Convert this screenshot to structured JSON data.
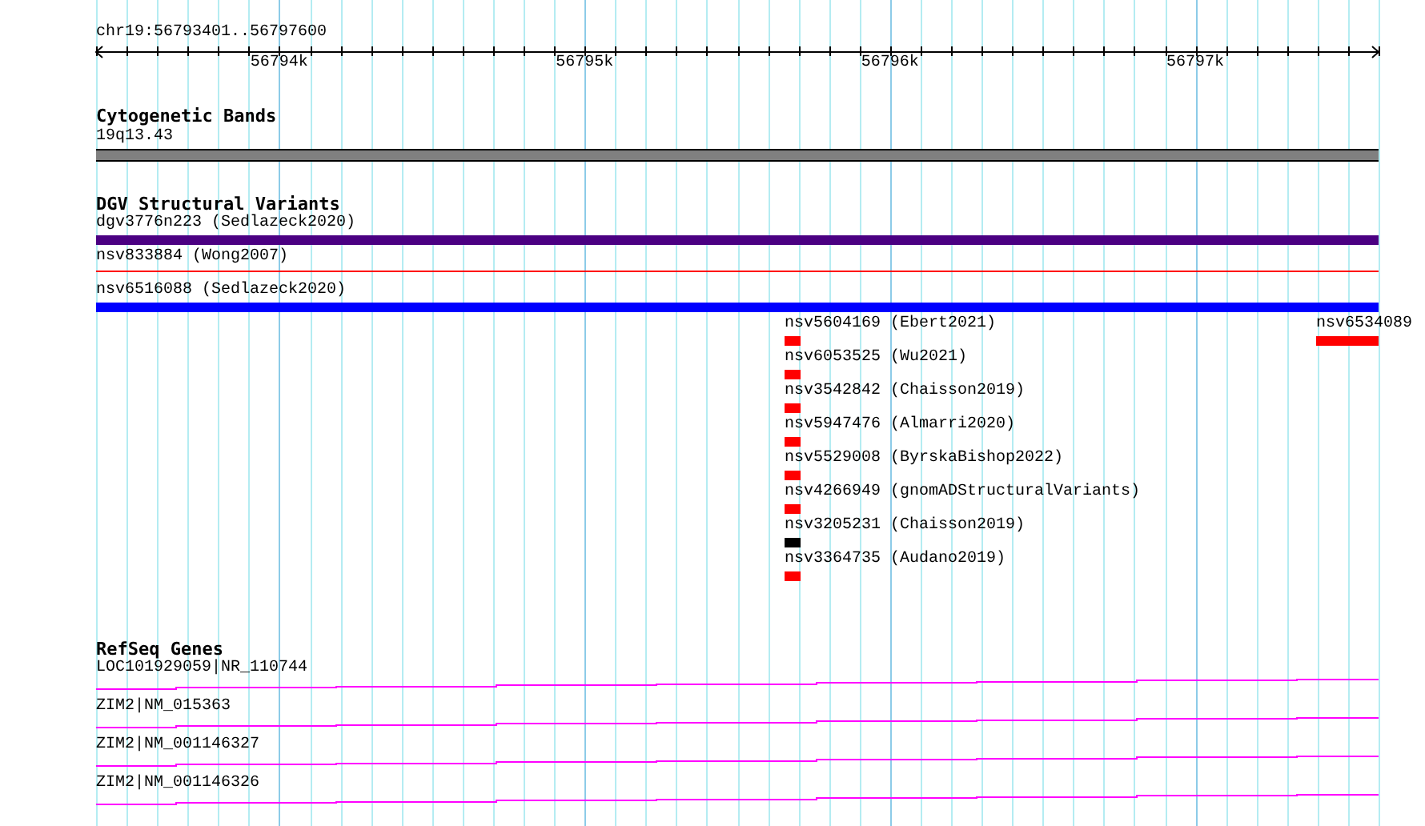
{
  "ruler": {
    "location": "chr19:56793401..56797600",
    "ticks": [
      "56794k",
      "56795k",
      "56796k",
      "56797k"
    ]
  },
  "tracks": [
    {
      "kind": "bands",
      "title": "Cytogenetic Bands",
      "features": [
        {
          "kind": "band",
          "label": "19q13.43",
          "color": "#808080"
        }
      ]
    },
    {
      "kind": "variants",
      "title": "DGV Structural Variants",
      "features": [
        {
          "kind": "full-bar",
          "label": "dgv3776n223 (Sedlazeck2020)",
          "color": "#4b0082"
        },
        {
          "kind": "full-line",
          "label": "nsv833884 (Wong2007)",
          "color": "#ff0000"
        },
        {
          "kind": "full-bar",
          "label": "nsv6516088 (Sedlazeck2020)",
          "color": "#0000ff"
        },
        {
          "kind": "short-bar",
          "label": "nsv5604169 (Ebert2021)",
          "color": "#ff0000"
        },
        {
          "kind": "end-bar",
          "label": "nsv6534089",
          "color": "#ff0000"
        },
        {
          "kind": "short-bar",
          "label": "nsv6053525 (Wu2021)",
          "color": "#ff0000"
        },
        {
          "kind": "short-bar",
          "label": "nsv3542842 (Chaisson2019)",
          "color": "#ff0000"
        },
        {
          "kind": "short-bar",
          "label": "nsv5947476 (Almarri2020)",
          "color": "#ff0000"
        },
        {
          "kind": "short-bar",
          "label": "nsv5529008 (ByrskaBishop2022)",
          "color": "#ff0000"
        },
        {
          "kind": "short-bar",
          "label": "nsv4266949 (gnomADStructuralVariants)",
          "color": "#ff0000"
        },
        {
          "kind": "short-bar",
          "label": "nsv3205231 (Chaisson2019)",
          "color": "#000000"
        },
        {
          "kind": "short-bar",
          "label": "nsv3364735 (Audano2019)",
          "color": "#ff0000"
        }
      ]
    },
    {
      "kind": "genes",
      "title": "RefSeq Genes",
      "features": [
        {
          "kind": "gene",
          "label": "LOC101929059|NR_110744",
          "color": "#ff00ff"
        },
        {
          "kind": "gene",
          "label": "ZIM2|NM_015363",
          "color": "#ff00ff"
        },
        {
          "kind": "gene",
          "label": "ZIM2|NM_001146327",
          "color": "#ff00ff"
        },
        {
          "kind": "gene",
          "label": "ZIM2|NM_001146326",
          "color": "#ff00ff"
        }
      ]
    }
  ]
}
